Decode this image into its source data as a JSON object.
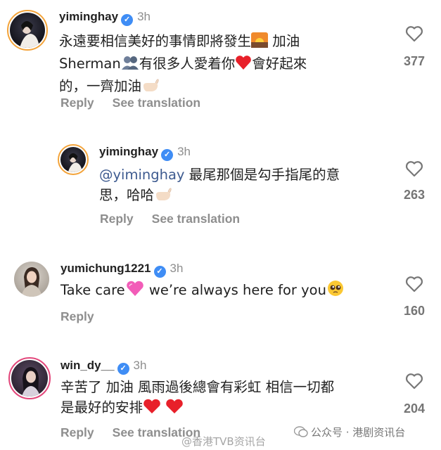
{
  "comments": [
    {
      "username": "yiminghay",
      "time": "3h",
      "line1": "永遠要相信美好的事情即將發生",
      "line1b": "加油",
      "line2a": "Sherman",
      "line2b": "有很多人愛着你",
      "line2c": "會好起來",
      "line3": "的，一齊加油",
      "reply": "Reply",
      "see_translation": "See translation",
      "likes": "377"
    },
    {
      "username": "yiminghay",
      "time": "3h",
      "mention": "@yiminghay",
      "line1": "最尾那個是勾手指尾的意",
      "line2": "思，哈哈",
      "reply": "Reply",
      "see_translation": "See translation",
      "likes": "263"
    },
    {
      "username": "yumichung1221",
      "time": "3h",
      "text_a": "Take care",
      "text_b": "we’re always here for you",
      "reply": "Reply",
      "likes": "160"
    },
    {
      "username": "win_dy__",
      "time": "3h",
      "line1": "辛苦了 加油 風雨過後總會有彩虹 相信一切都",
      "line2": "是最好的安排",
      "reply": "Reply",
      "see_translation": "See translation",
      "likes": "204"
    }
  ],
  "watermark": {
    "left": "@香港TVB资讯台",
    "right": "公众号 · 港剧资讯台"
  },
  "colors": {
    "verified": "#3f8df5",
    "muted": "#8e8e8e",
    "mention": "#3d5a8f",
    "heart_emoji": "#e8202a",
    "pink_heart": "#f25cb8"
  },
  "icons": [
    "verified-badge-icon",
    "heart-outline-icon",
    "sunrise-emoji",
    "silhouette-emoji",
    "red-heart-emoji",
    "pinky-promise-emoji",
    "pink-heart-emoji",
    "pleading-face-emoji"
  ]
}
